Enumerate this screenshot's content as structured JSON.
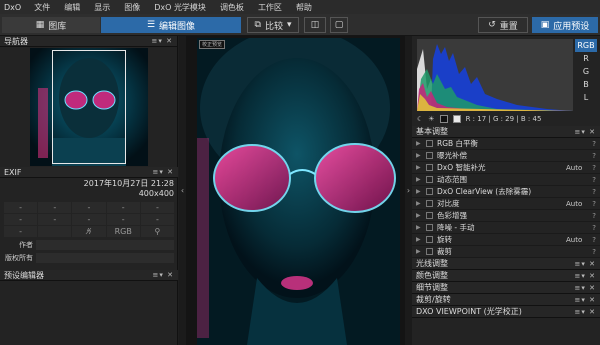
{
  "menu": {
    "logo": "DxO",
    "items": [
      "文件",
      "编辑",
      "显示",
      "图像",
      "DxO 光学模块",
      "调色板",
      "工作区",
      "帮助"
    ]
  },
  "toolbar": {
    "library_tab": "图库",
    "edit_tab": "编辑图像",
    "compare_label": "比较",
    "reset_label": "重置",
    "apply_preset_label": "应用预设"
  },
  "left": {
    "navigator_title": "导航器",
    "exif_title": "EXIF",
    "exif_date": "2017年10月27日 21:28",
    "exif_size": "400x400",
    "exif_grid": [
      "-",
      "-",
      "-",
      "-",
      "-",
      "-",
      "-",
      "-",
      "-",
      "-",
      "-",
      "",
      "",
      "RGB",
      ""
    ],
    "author_label": "作者",
    "copyright_label": "版权所有",
    "preset_editor_title": "预设编辑器"
  },
  "viewer": {
    "photo_label": "校正预览"
  },
  "right": {
    "hist_tabs": [
      "RGB",
      "R",
      "G",
      "B",
      "L"
    ],
    "hist_active": "RGB",
    "pixel_readout": "R : 17 | G : 29 | B : 45",
    "basic_title": "基本调整",
    "adjustments": [
      {
        "name": "RGB 白平衡",
        "status": ""
      },
      {
        "name": "曝光补偿",
        "status": ""
      },
      {
        "name": "DxO 智能补光",
        "status": "Auto"
      },
      {
        "name": "动态范围",
        "status": ""
      },
      {
        "name": "DxO ClearView (去除雾霾)",
        "status": ""
      },
      {
        "name": "对比度",
        "status": "Auto"
      },
      {
        "name": "色彩增强",
        "status": ""
      },
      {
        "name": "降噪 - 手动",
        "status": ""
      },
      {
        "name": "旋转",
        "status": "Auto"
      },
      {
        "name": "裁剪",
        "status": ""
      }
    ],
    "sections": [
      "光线调整",
      "颜色调整",
      "细节调整",
      "裁剪/旋转",
      "DXO VIEWPOINT (光学校正)"
    ]
  },
  "colors": {
    "accent": "#2c6aa8",
    "panel": "#232323",
    "photo_teal": "#0b5e74",
    "lens_pink": "#e0308a"
  }
}
